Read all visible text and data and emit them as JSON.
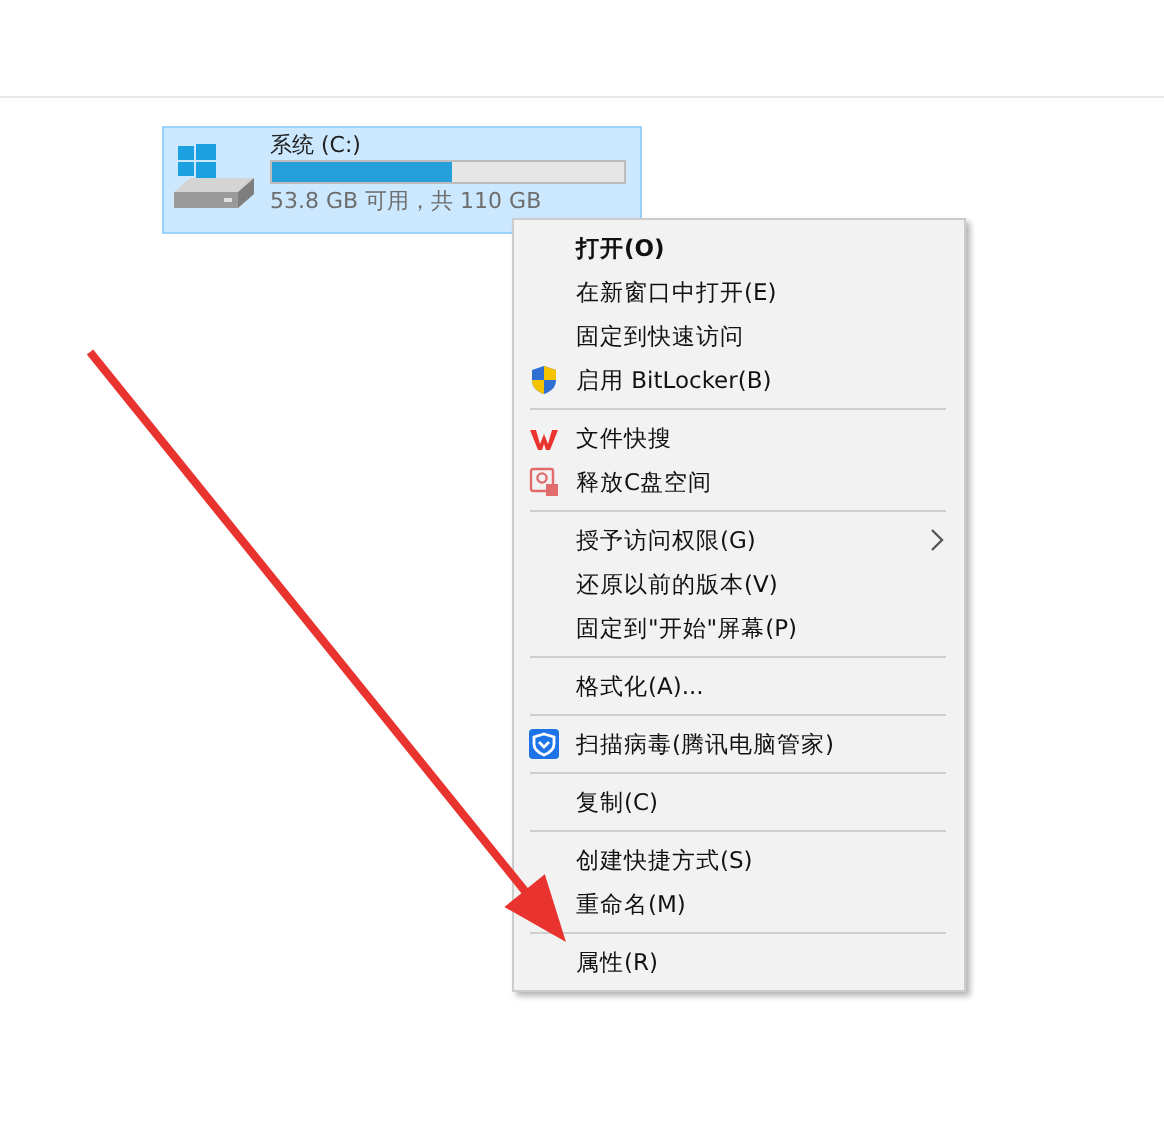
{
  "drive": {
    "name": "系统 (C:)",
    "level": 0.51,
    "space": "53.8 GB 可用，共 110 GB",
    "selected": true
  },
  "context_menu": {
    "items": [
      {
        "kind": "item",
        "label": "打开(O)",
        "default": true
      },
      {
        "kind": "item",
        "label": "在新窗口中打开(E)"
      },
      {
        "kind": "item",
        "label": "固定到快速访问"
      },
      {
        "kind": "shield",
        "label": "启用 BitLocker(B)"
      },
      {
        "kind": "separator"
      },
      {
        "kind": "wps",
        "label": "文件快搜"
      },
      {
        "kind": "cleanup",
        "label": "释放C盘空间"
      },
      {
        "kind": "separator"
      },
      {
        "kind": "item",
        "label": "授予访问权限(G)",
        "submenu": true
      },
      {
        "kind": "item",
        "label": "还原以前的版本(V)"
      },
      {
        "kind": "item",
        "label": "固定到\"开始\"屏幕(P)"
      },
      {
        "kind": "separator"
      },
      {
        "kind": "item",
        "label": "格式化(A)..."
      },
      {
        "kind": "separator"
      },
      {
        "kind": "guard",
        "label": "扫描病毒(腾讯电脑管家)"
      },
      {
        "kind": "separator"
      },
      {
        "kind": "item",
        "label": "复制(C)"
      },
      {
        "kind": "separator"
      },
      {
        "kind": "item",
        "label": "创建快捷方式(S)"
      },
      {
        "kind": "item",
        "label": "重命名(M)"
      },
      {
        "kind": "separator"
      },
      {
        "kind": "item",
        "label": "属性(R)"
      }
    ]
  }
}
